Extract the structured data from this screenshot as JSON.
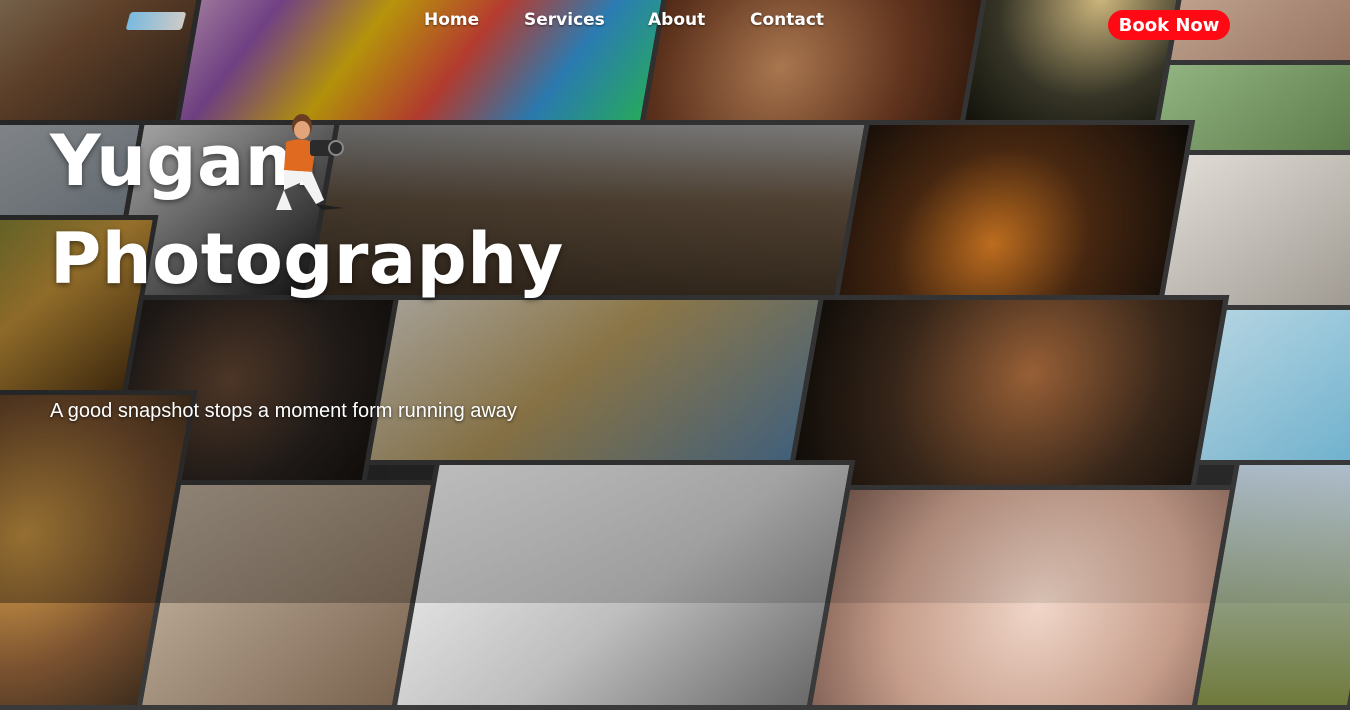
{
  "nav": {
    "items": [
      {
        "label": "Home"
      },
      {
        "label": "Services"
      },
      {
        "label": "About"
      },
      {
        "label": "Contact"
      }
    ],
    "cta_label": "Book Now",
    "cta_color": "#ff0a14"
  },
  "hero": {
    "title_line1": "Yugam",
    "title_line2": "Photography",
    "tagline": "A good snapshot stops a moment form running away"
  },
  "icons": {
    "logo": "yugam-logo",
    "mascot": "photographer-mascot-icon"
  },
  "colors": {
    "text": "#ffffff",
    "accent": "#ff0a14"
  }
}
